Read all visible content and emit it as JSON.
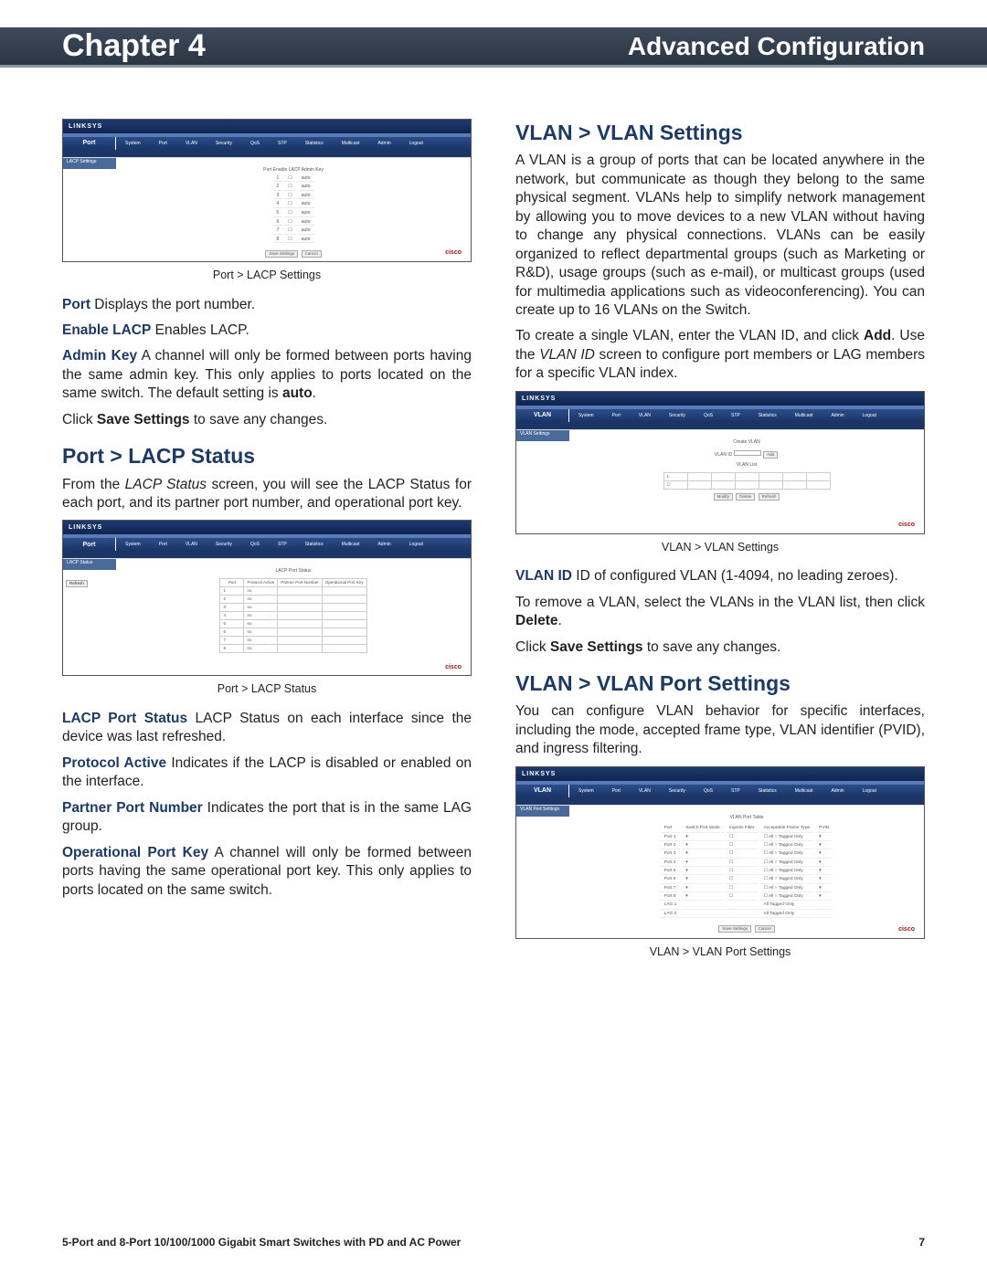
{
  "header": {
    "chapter": "Chapter 4",
    "title": "Advanced Configuration"
  },
  "left": {
    "ss1": {
      "logo": "LINKSYS",
      "tab": "Port",
      "menu": [
        "System",
        "Port",
        "VLAN",
        "Security",
        "QoS",
        "STP",
        "Statistics",
        "Multicast",
        "Admin",
        "Logout"
      ],
      "sidelabel": "LACP Settings",
      "table_title": "Port Enable LACP Admin Key",
      "rows": [
        [
          "1",
          "☐",
          "auto"
        ],
        [
          "2",
          "☐",
          "auto"
        ],
        [
          "3",
          "☐",
          "auto"
        ],
        [
          "4",
          "☐",
          "auto"
        ],
        [
          "5",
          "☐",
          "auto"
        ],
        [
          "6",
          "☐",
          "auto"
        ],
        [
          "7",
          "☐",
          "auto"
        ],
        [
          "8",
          "☐",
          "auto"
        ]
      ],
      "btns": [
        "Save Settings",
        "Cancel"
      ],
      "cisco": "cisco"
    },
    "cap1": "Port > LACP Settings",
    "p1a": "Port",
    "p1b": "  Displays the port number.",
    "p2a": "Enable LACP",
    "p2b": "  Enables LACP.",
    "p3a": "Admin Key",
    "p3b": "  A channel will only be formed between ports having the same admin key. This only applies to ports located on the same switch. The default setting is ",
    "p3c": "auto",
    "p3d": ".",
    "p4a": "Click ",
    "p4b": "Save Settings",
    "p4c": " to save any changes.",
    "h2a": "Port > LACP Status",
    "p5a": "From the ",
    "p5b": "LACP Status",
    "p5c": " screen, you will see the LACP Status for each port, and its partner port number, and operational port key.",
    "ss2": {
      "logo": "LINKSYS",
      "tab": "Port",
      "sidelabel": "LACP Status",
      "refresh": "Refresh",
      "tbl_title": "LACP Port Status",
      "cols": [
        "Port",
        "Protocol Active",
        "Partner Port Number",
        "Operational Port Key"
      ],
      "rows": [
        [
          "1",
          "no"
        ],
        [
          "2",
          "no"
        ],
        [
          "3",
          "no"
        ],
        [
          "4",
          "no"
        ],
        [
          "5",
          "no"
        ],
        [
          "6",
          "no"
        ],
        [
          "7",
          "no"
        ],
        [
          "8",
          "no"
        ]
      ],
      "cisco": "cisco"
    },
    "cap2": "Port > LACP Status",
    "p6a": "LACP Port Status",
    "p6b": "  LACP Status on each interface since the device was last refreshed.",
    "p7a": "Protocol Active",
    "p7b": "  Indicates if the LACP is disabled or enabled on the interface.",
    "p8a": "Partner Port Number",
    "p8b": "  Indicates the port that is in the same LAG group.",
    "p9a": "Operational Port Key",
    "p9b": "  A channel will only be formed between ports having the same operational port key. This only applies to ports located on the same switch."
  },
  "right": {
    "h2a": "VLAN > VLAN Settings",
    "p1": "A VLAN is a group of ports that can be located anywhere in the network, but communicate as though they belong to the same physical segment. VLANs help to simplify network management by allowing you to move devices to a new VLAN without having to change any physical connections. VLANs can be easily organized to reflect departmental groups (such as Marketing or R&D), usage groups (such as e-mail), or multicast groups (used for multimedia applications such as videoconferencing). You can create up to 16 VLANs on the Switch.",
    "p2a": "To create a single VLAN, enter the VLAN ID, and click ",
    "p2b": "Add",
    "p2c": ". Use the ",
    "p2d": "VLAN ID",
    "p2e": " screen to configure port members or LAG members for a specific VLAN index.",
    "ss1": {
      "logo": "LINKSYS",
      "tab": "VLAN",
      "sidelabel": "VLAN Settings",
      "create": "Create VLAN",
      "vid": "VLAN ID",
      "add": "Add",
      "list": "VLAN List",
      "btns": [
        "Modify",
        "Delete",
        "Refresh"
      ],
      "cisco": "cisco"
    },
    "cap1": "VLAN > VLAN Settings",
    "p3a": "VLAN ID",
    "p3b": " ID of configured VLAN (1-4094, no leading zeroes).",
    "p4a": "To remove a VLAN, select the VLANs in the VLAN list, then click ",
    "p4b": "Delete",
    "p4c": ".",
    "p5a": "Click ",
    "p5b": "Save Settings",
    "p5c": " to save any changes.",
    "h2b": "VLAN > VLAN Port Settings",
    "p6": "You can configure VLAN behavior for specific interfaces, including the mode, accepted frame type, VLAN identifier (PVID), and ingress filtering.",
    "ss2": {
      "logo": "LINKSYS",
      "tab": "VLAN",
      "sidelabel": "VLAN Port Settings",
      "tbl_title": "VLAN Port Table",
      "cols": [
        "Port",
        "Switch Port Mode",
        "Ingress Filter",
        "Acceptable Frame Type",
        "PVID"
      ],
      "rows": [
        [
          "Port 1",
          "",
          "",
          "☐ All  ○ Tagged Only",
          ""
        ],
        [
          "Port 2",
          "",
          "",
          "☐ All  ○ Tagged Only",
          ""
        ],
        [
          "Port 3",
          "",
          "",
          "☐ All  ○ Tagged Only",
          ""
        ],
        [
          "Port 4",
          "",
          "",
          "☐ All  ○ Tagged Only",
          ""
        ],
        [
          "Port 5",
          "",
          "",
          "☐ All  ○ Tagged Only",
          ""
        ],
        [
          "Port 6",
          "",
          "",
          "☐ All  ○ Tagged Only",
          ""
        ],
        [
          "Port 7",
          "",
          "",
          "☐ All  ○ Tagged Only",
          ""
        ],
        [
          "Port 8",
          "",
          "",
          "☐ All  ○ Tagged Only",
          ""
        ],
        [
          "LAG 1",
          "",
          "",
          "All    Tagged Only",
          ""
        ],
        [
          "LAG 2",
          "",
          "",
          "All    Tagged Only",
          ""
        ]
      ],
      "btns": [
        "Save Settings",
        "Cancel"
      ],
      "cisco": "cisco"
    },
    "cap2": "VLAN > VLAN Port Settings"
  },
  "footer": {
    "left": "5-Port and 8-Port 10/100/1000 Gigabit Smart Switches with PD and AC Power",
    "right": "7"
  }
}
